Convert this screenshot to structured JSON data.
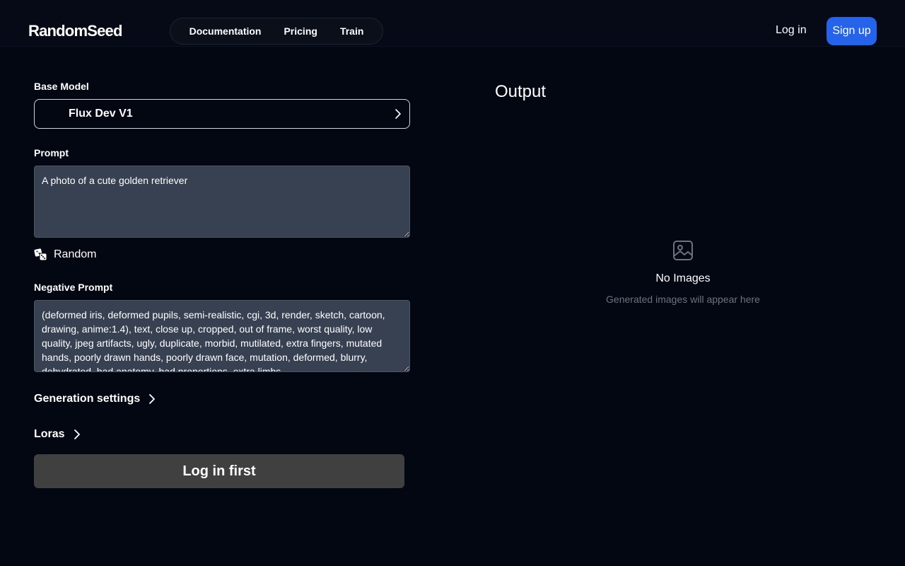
{
  "header": {
    "logo": "RandomSeed",
    "nav": [
      "Documentation",
      "Pricing",
      "Train"
    ],
    "login_label": "Log in",
    "signup_label": "Sign up",
    "signup_color": "#2563eb"
  },
  "form": {
    "base_model_label": "Base Model",
    "base_model_value": "Flux Dev V1",
    "prompt_label": "Prompt",
    "prompt_value": "A photo of a cute golden retriever",
    "random_label": "Random",
    "negative_label": "Negative Prompt",
    "negative_value": "(deformed iris, deformed pupils, semi-realistic, cgi, 3d, render, sketch, cartoon, drawing, anime:1.4), text, close up, cropped, out of frame, worst quality, low quality, jpeg artifacts, ugly, duplicate, morbid, mutilated, extra fingers, mutated hands, poorly drawn hands, poorly drawn face, mutation, deformed, blurry, dehydrated, bad anatomy, bad proportions, extra limbs",
    "generation_settings_label": "Generation settings",
    "loras_label": "Loras",
    "submit_label": "Log in first"
  },
  "output": {
    "title": "Output",
    "empty_title": "No Images",
    "empty_subtitle": "Generated images will appear here",
    "empty_icon": "image-icon"
  }
}
